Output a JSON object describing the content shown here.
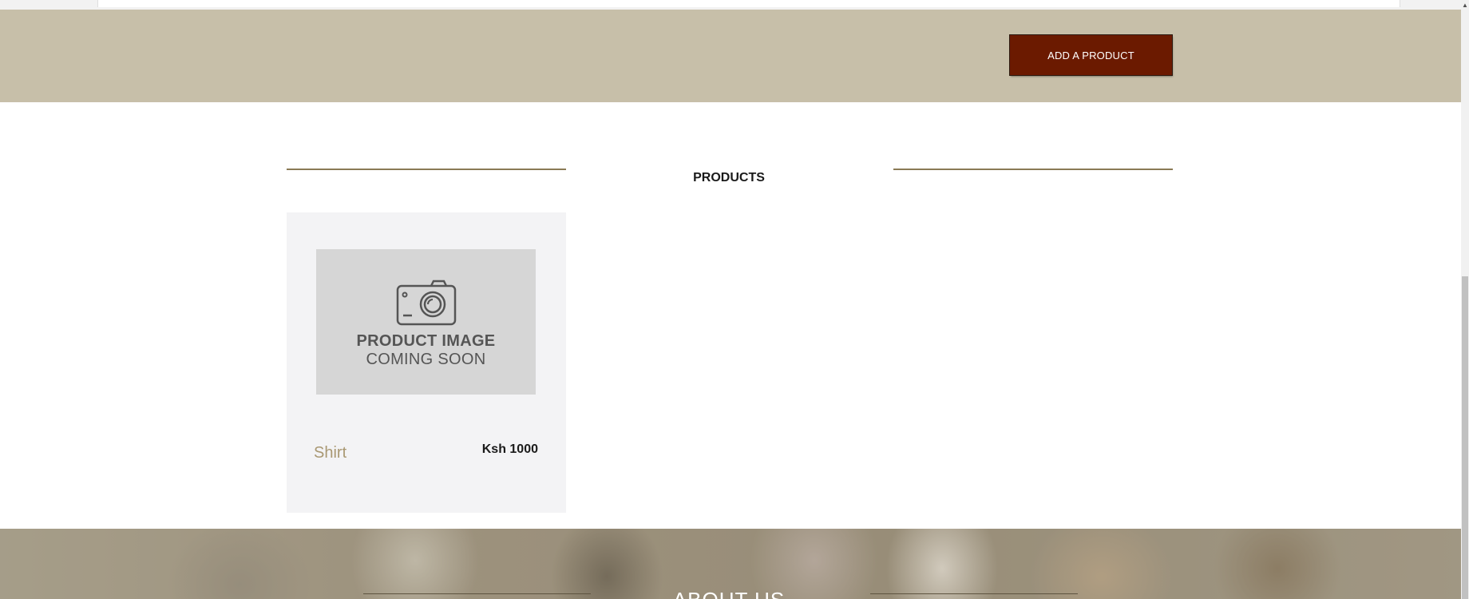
{
  "header": {
    "add_product_label": "ADD A PRODUCT"
  },
  "products_section": {
    "title": "PRODUCTS",
    "items": [
      {
        "image_placeholder_line1": "PRODUCT IMAGE",
        "image_placeholder_line2": "COMING SOON",
        "name": "Shirt",
        "price": "Ksh 1000"
      }
    ]
  },
  "about_section": {
    "title": "ABOUT US"
  },
  "colors": {
    "banner": "#c7bfa9",
    "button": "#6b1a00",
    "accent_line": "#8a7a55",
    "product_name": "#a99873",
    "card_bg": "#f3f3f5"
  },
  "icons": {
    "placeholder": "camera-icon",
    "scroll_up": "arrow-up-icon"
  }
}
